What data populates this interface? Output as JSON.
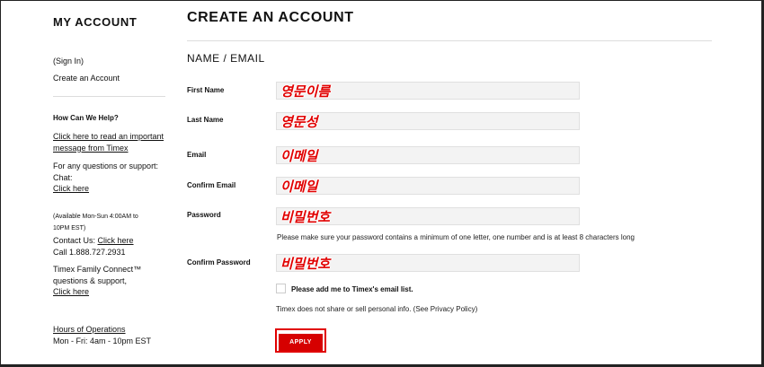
{
  "sidebar": {
    "title": "MY ACCOUNT",
    "sign_in": "(Sign In)",
    "create_account": "Create an Account",
    "help_heading": "How Can We Help?",
    "important_line1": "Click here to read an important",
    "important_line2": "message from Timex",
    "support_line1": "For any questions or support:",
    "support_line2": "Chat:",
    "chat_link": "Click here",
    "availability_line1": "(Available Mon-Sun 4:00AM to",
    "availability_line2": "10PM EST)",
    "contact_prefix": "Contact Us: ",
    "contact_link": "Click here",
    "call": "Call 1.888.727.2931",
    "family_line1": "Timex Family Connect™",
    "family_line2": "questions & support,",
    "family_link": "Click here",
    "hours_heading": "Hours of Operations",
    "hours": "Mon - Fri: 4am - 10pm EST"
  },
  "main": {
    "title": "CREATE AN ACCOUNT",
    "section": "NAME / EMAIL",
    "fields": {
      "first_name": {
        "label": "First Name",
        "value": "영문이름"
      },
      "last_name": {
        "label": "Last Name",
        "value": "영문성"
      },
      "email": {
        "label": "Email",
        "value": "이메일"
      },
      "confirm_email": {
        "label": "Confirm Email",
        "value": "이메일"
      },
      "password": {
        "label": "Password",
        "value": "비밀번호"
      },
      "confirm_password": {
        "label": "Confirm Password",
        "value": "비밀번호"
      }
    },
    "password_hint": "Please make sure your password contains a minimum of one letter, one number and is at least 8 characters long",
    "email_list_label": "Please add me to Timex's email list.",
    "privacy_note": "Timex does not share or sell personal info. (See Privacy Policy)",
    "apply_label": "APPLY"
  },
  "colors": {
    "accent": "#d60000",
    "annotation": "#e10000"
  }
}
